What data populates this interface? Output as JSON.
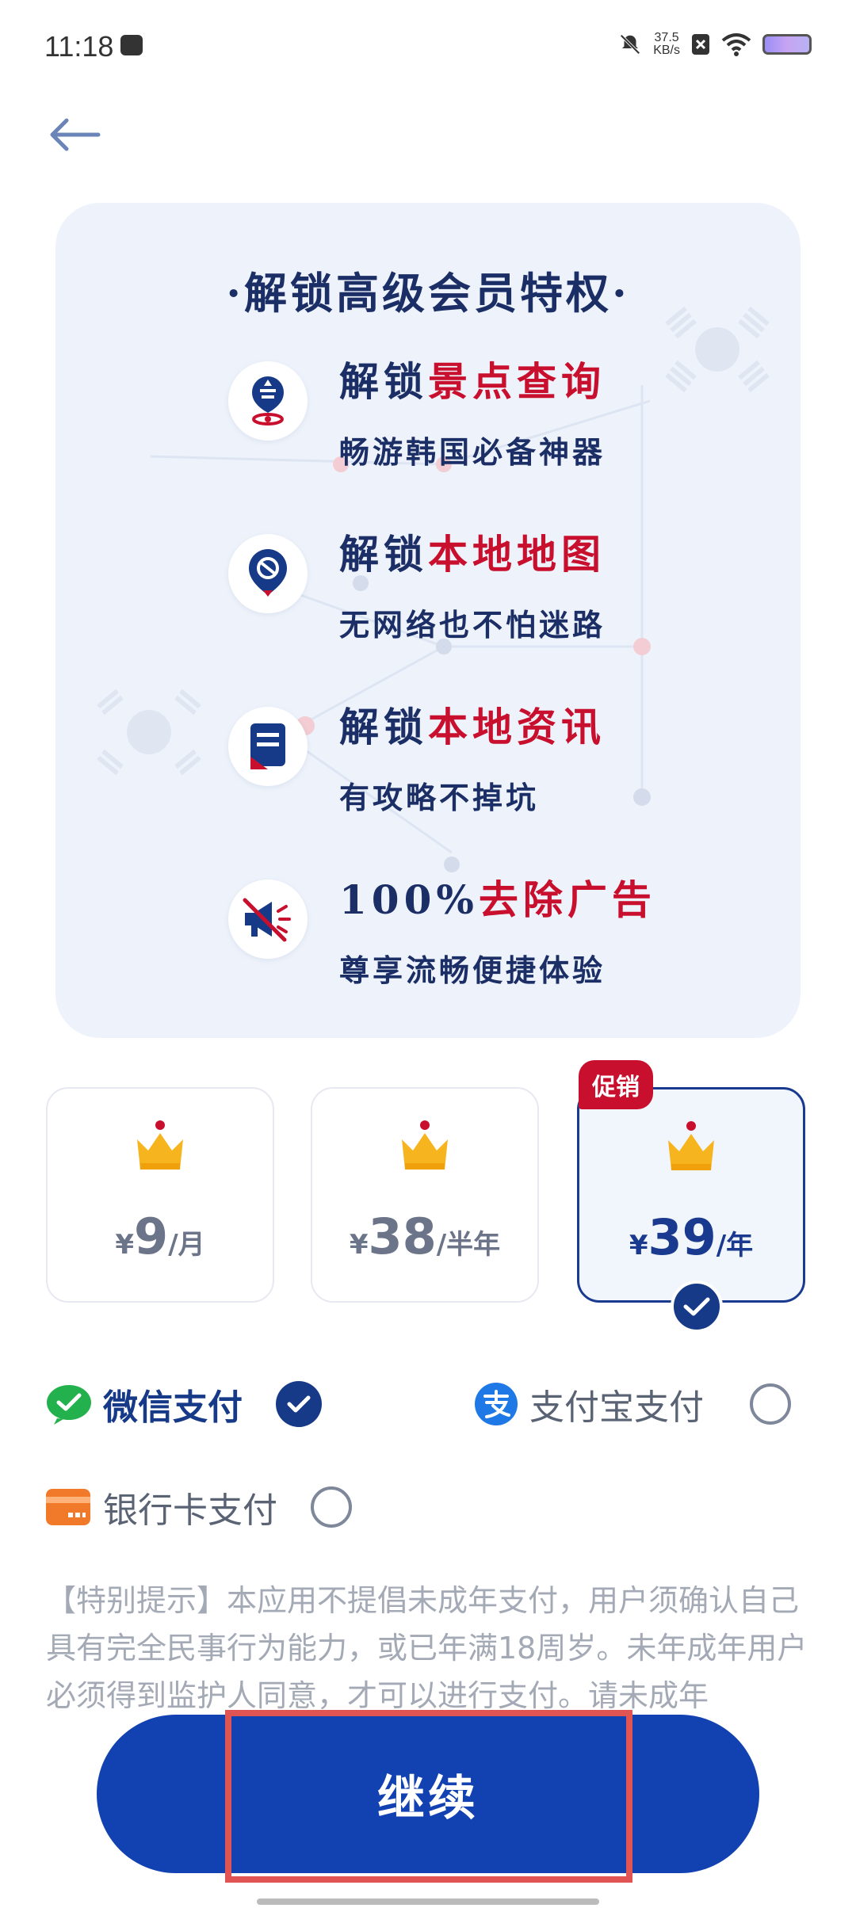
{
  "status_bar": {
    "time": "11:18",
    "net_speed_value": "37.5",
    "net_speed_unit": "KB/s"
  },
  "card": {
    "title": "·解锁高级会员特权·",
    "benefits": [
      {
        "title_prefix": "解锁",
        "title_highlight": "景点查询",
        "subtitle": "畅游韩国必备神器",
        "icon": "location-pin-icon"
      },
      {
        "title_prefix": "解锁",
        "title_highlight": "本地地图",
        "subtitle": "无网络也不怕迷路",
        "icon": "map-icon"
      },
      {
        "title_prefix": "解锁",
        "title_highlight": "本地资讯",
        "subtitle": "有攻略不掉坑",
        "icon": "news-icon"
      },
      {
        "title_prefix": "100%",
        "title_highlight": "去除广告",
        "subtitle": "尊享流畅便捷体验",
        "icon": "no-ads-icon"
      }
    ]
  },
  "plans": [
    {
      "currency": "¥",
      "price": "9",
      "unit": "/月",
      "selected": false
    },
    {
      "currency": "¥",
      "price": "38",
      "unit": "/半年",
      "selected": false
    },
    {
      "currency": "¥",
      "price": "39",
      "unit": "/年",
      "selected": true,
      "badge": "促销"
    }
  ],
  "payment": {
    "wechat": "微信支付",
    "alipay": "支付宝支付",
    "bank": "银行卡支付",
    "selected": "wechat"
  },
  "notice": "【特别提示】本应用不提倡未成年支付，用户须确认自己具有完全民事行为能力，或已年满18周岁。未年成年用户必须得到监护人同意，才可以进行支付。请未成年",
  "continue_label": "继续",
  "colors": {
    "primary": "#1241b1",
    "accent_red": "#c8102e",
    "navy": "#163a88"
  }
}
